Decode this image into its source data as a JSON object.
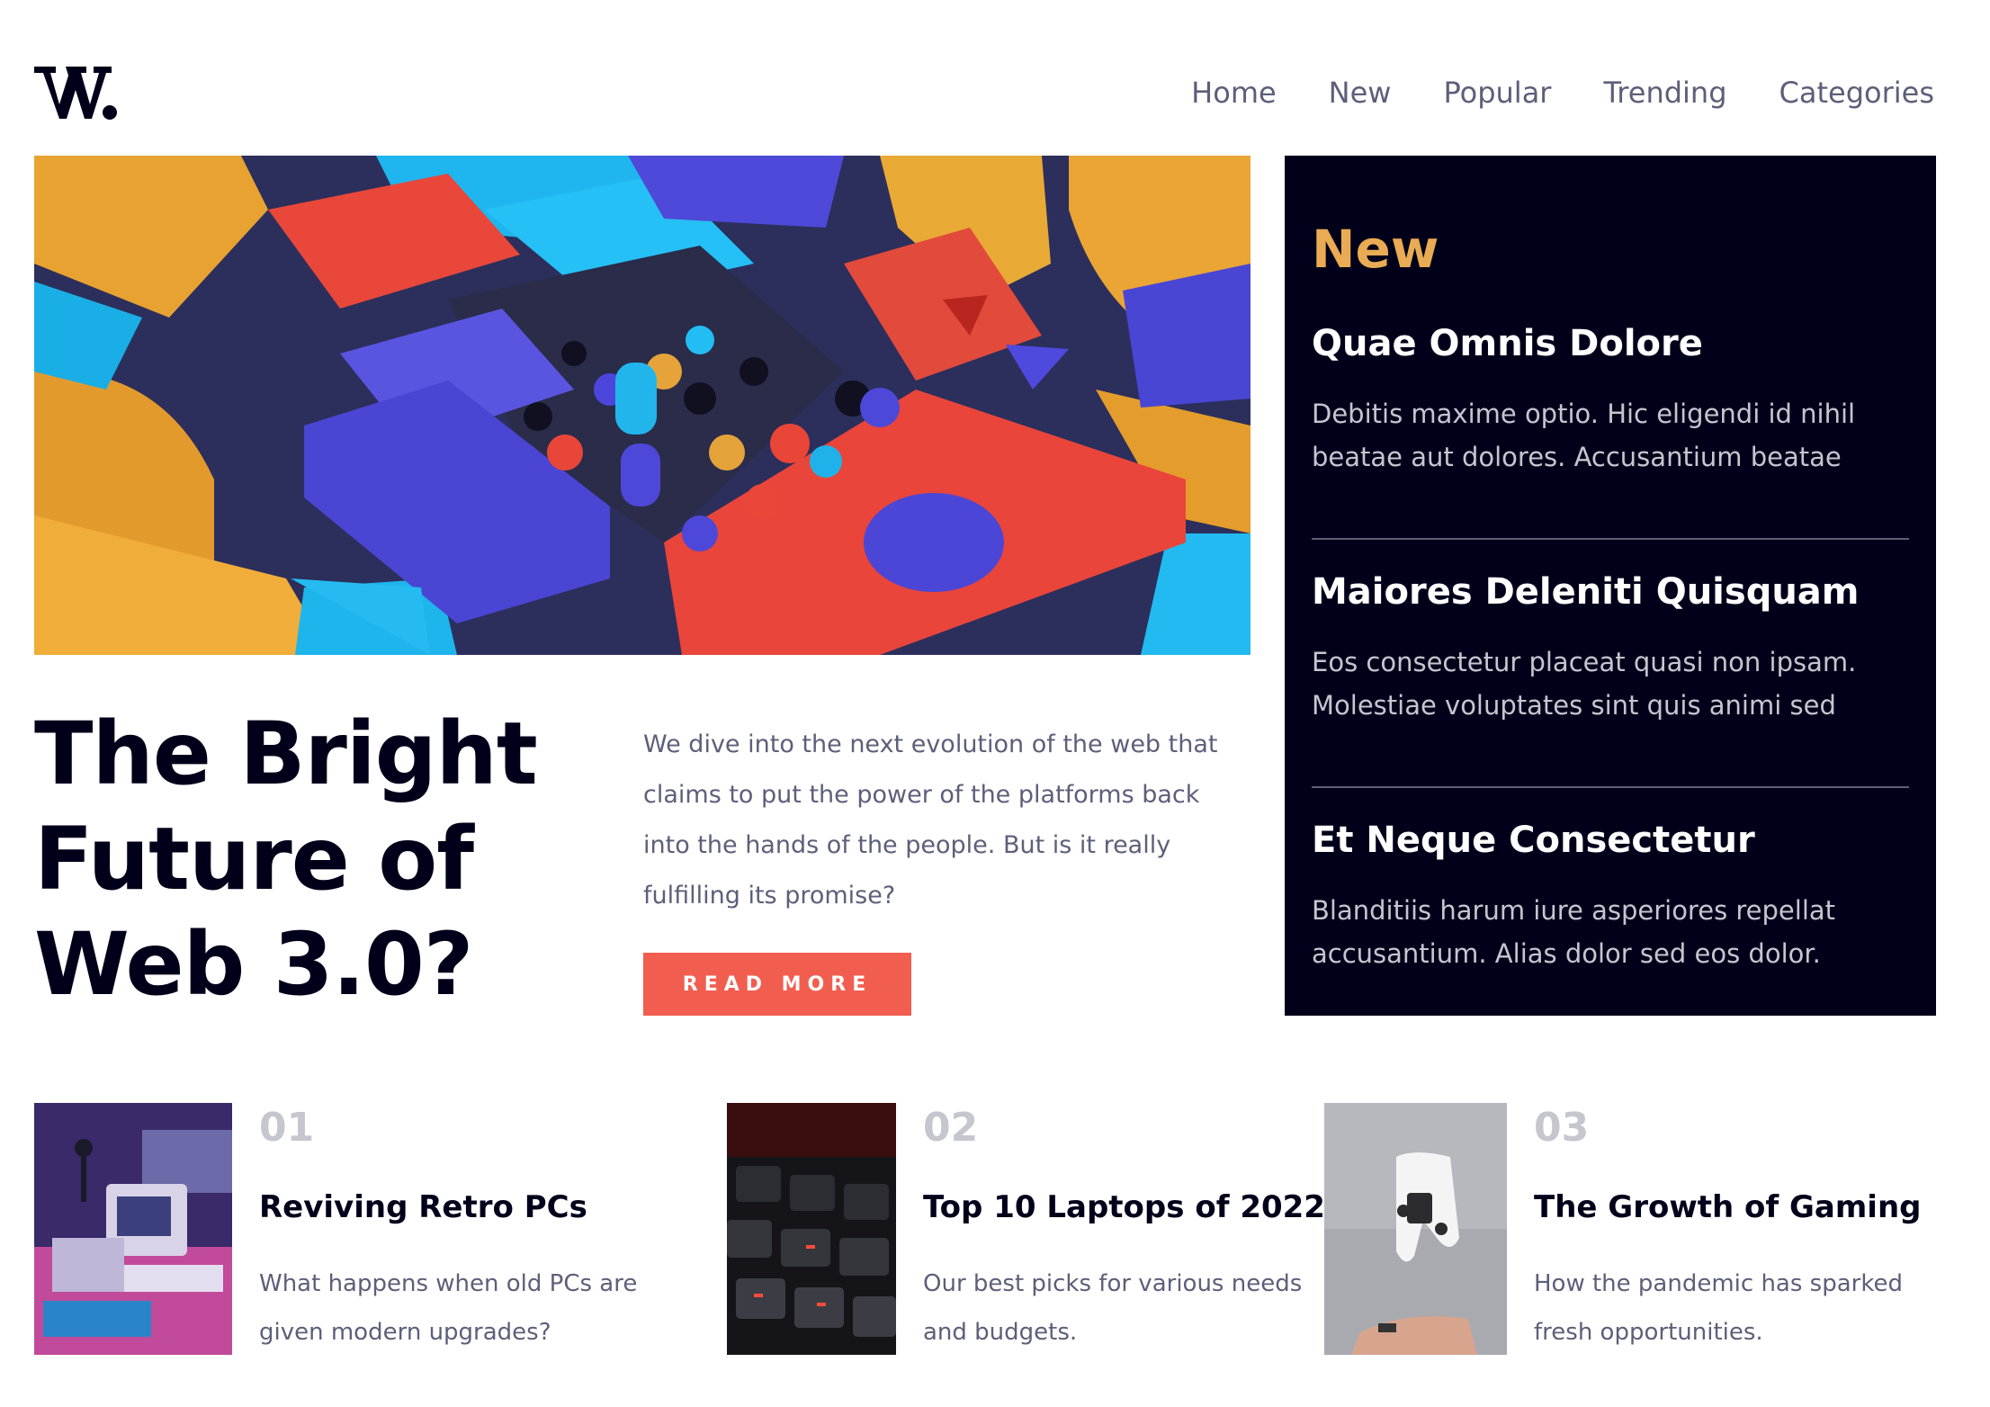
{
  "brand": {
    "logo_text": "W."
  },
  "nav": [
    {
      "label": "Home"
    },
    {
      "label": "New"
    },
    {
      "label": "Popular"
    },
    {
      "label": "Trending"
    },
    {
      "label": "Categories"
    }
  ],
  "hero": {
    "title": "The Bright Future of Web 3.0?",
    "description": "We dive into the next evolution of the web that claims to put the power of the platforms back into the hands of the people. But is it really fulfilling its promise?",
    "button": "READ MORE"
  },
  "new_panel": {
    "heading": "New",
    "items": [
      {
        "title": "Quae Omnis Dolore",
        "text": "Debitis maxime optio. Hic eligendi id nihil beatae aut dolores. Accusantium beatae"
      },
      {
        "title": "Maiores Deleniti Quisquam",
        "text": "Eos consectetur placeat quasi non ipsam. Molestiae voluptates sint quis animi sed"
      },
      {
        "title": "Et Neque Consectetur",
        "text": "Blanditiis harum iure asperiores repellat accusantium. Alias dolor sed eos dolor."
      }
    ]
  },
  "articles": [
    {
      "num": "01",
      "title": "Reviving Retro PCs",
      "text": "What happens when old PCs are given modern upgrades?"
    },
    {
      "num": "02",
      "title": "Top 10 Laptops of 2022",
      "text": "Our best picks for various needs and budgets."
    },
    {
      "num": "03",
      "title": "The Growth of Gaming",
      "text": "How the pandemic has sparked fresh opportunities."
    }
  ],
  "colors": {
    "dark": "#00001a",
    "accent": "#f15e50",
    "gold": "#e9ab53",
    "muted": "#5d5f79",
    "light_muted": "#c5c6ce"
  }
}
